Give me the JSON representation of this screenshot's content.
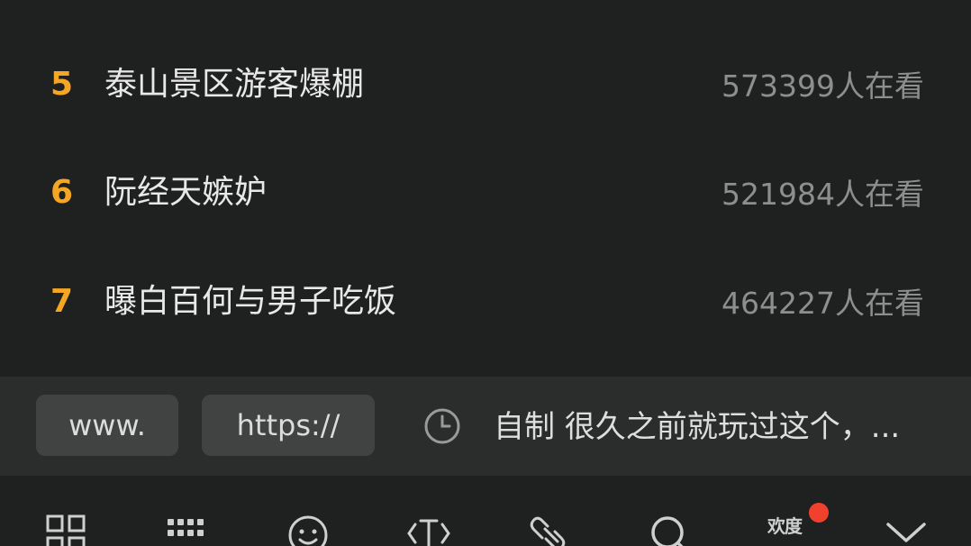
{
  "trending": [
    {
      "rank": "5",
      "title": "泰山景区游客爆棚",
      "viewers": "573399人在看"
    },
    {
      "rank": "6",
      "title": "阮经天嫉妒",
      "viewers": "521984人在看"
    },
    {
      "rank": "7",
      "title": "曝白百何与男子吃饭",
      "viewers": "464227人在看"
    }
  ],
  "suggestions": {
    "chip_www": "www.",
    "chip_https": "https://",
    "history_icon": "clock-icon",
    "history_text": "自制 很久之前就玩过这个，..."
  },
  "toolbar": {
    "icons": [
      "grid-icon",
      "keypad-icon",
      "emoji-icon",
      "text-cursor-icon",
      "link-icon",
      "search-icon",
      "baidu-logo-icon",
      "chevron-down-icon"
    ],
    "baidu_label": "欢度",
    "notify_color": "#f0412c"
  },
  "colors": {
    "rank": "#f5a623",
    "background": "#1f2020",
    "suggest_bar": "#2b2c2c"
  }
}
